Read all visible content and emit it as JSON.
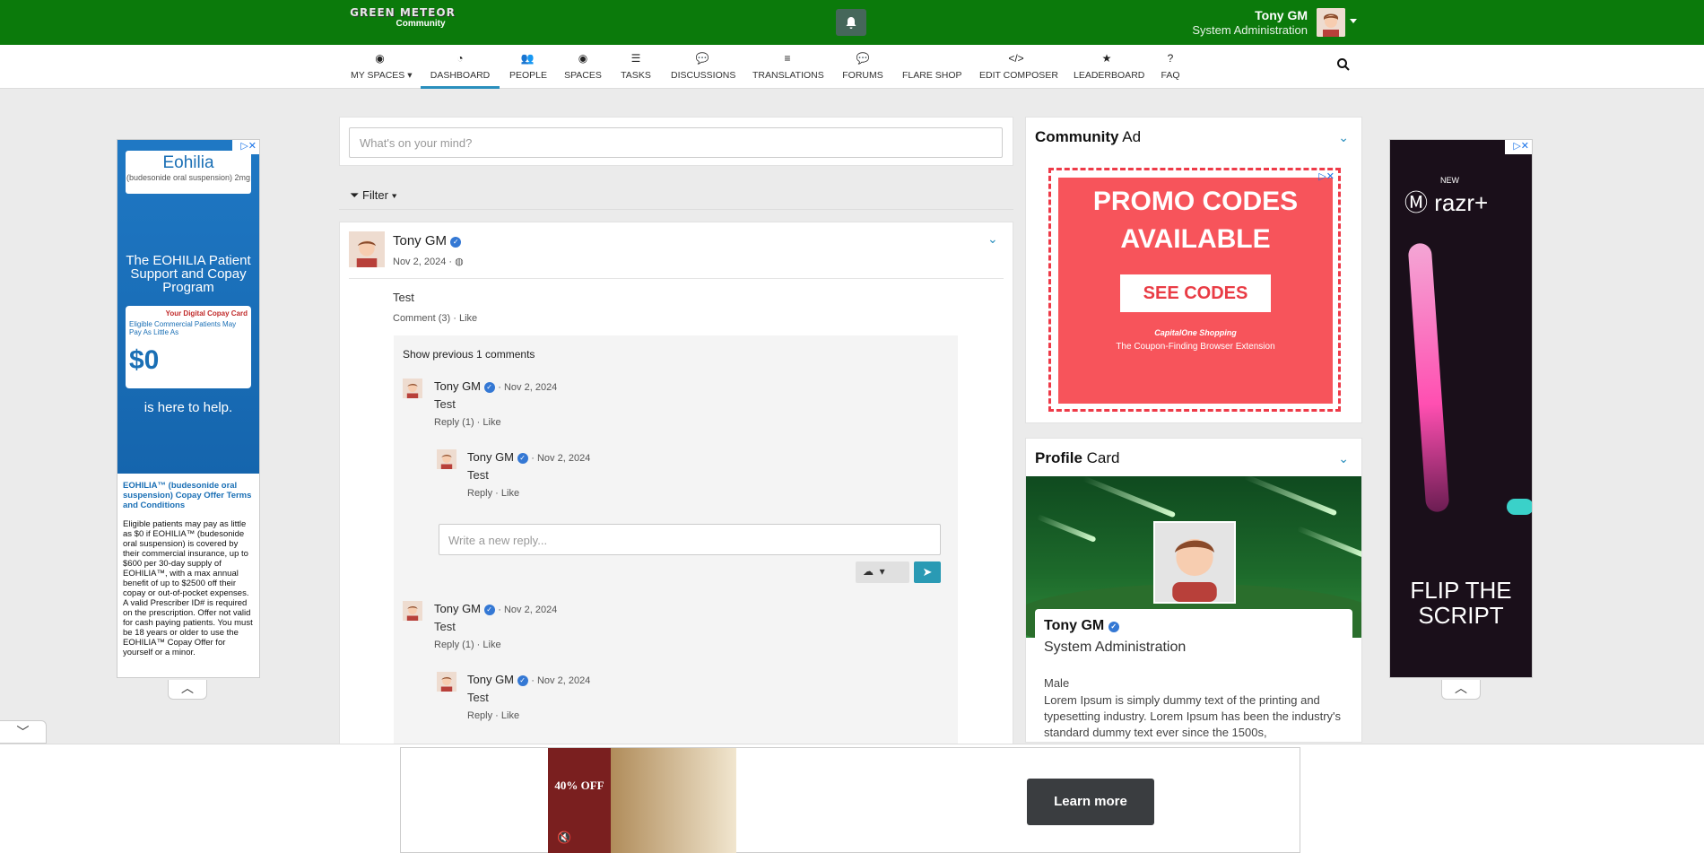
{
  "header": {
    "logo_line1": "GREEN METEOR",
    "logo_line2": "Community",
    "user_name": "Tony GM",
    "user_role": "System Administration",
    "bg_color": "#0b7a0b"
  },
  "nav": {
    "items": [
      {
        "label": "MY SPACES",
        "icon": "target-icon"
      },
      {
        "label": "DASHBOARD",
        "icon": "dashboard-icon"
      },
      {
        "label": "PEOPLE",
        "icon": "people-icon"
      },
      {
        "label": "SPACES",
        "icon": "target-icon"
      },
      {
        "label": "TASKS",
        "icon": "tasks-icon"
      },
      {
        "label": "DISCUSSIONS",
        "icon": "chat-icon"
      },
      {
        "label": "TRANSLATIONS",
        "icon": "lines-icon"
      },
      {
        "label": "FORUMS",
        "icon": "chat-icon"
      },
      {
        "label": "FLARE SHOP",
        "icon": "none"
      },
      {
        "label": "EDIT COMPOSER",
        "icon": "code-icon"
      },
      {
        "label": "LEADERBOARD",
        "icon": "star-icon"
      },
      {
        "label": "FAQ",
        "icon": "question-icon"
      }
    ],
    "active": "DASHBOARD"
  },
  "composer": {
    "placeholder": "What's on your mind?"
  },
  "filter_label": "Filter",
  "post": {
    "author": "Tony GM",
    "date": "Nov 2, 2024",
    "text": "Test",
    "comment_link": "Comment (3)",
    "like": "Like",
    "show_previous": "Show previous 1 comments",
    "comments": [
      {
        "author": "Tony GM",
        "date": "· Nov 2, 2024",
        "text": "Test",
        "reply": "Reply (1)",
        "like": "Like"
      },
      {
        "author": "Tony GM",
        "date": "· Nov 2, 2024",
        "text": "Test",
        "reply": "Reply",
        "like": "Like"
      },
      {
        "author": "Tony GM",
        "date": "· Nov 2, 2024",
        "text": "Test",
        "reply": "Reply (1)",
        "like": "Like"
      },
      {
        "author": "Tony GM",
        "date": "· Nov 2, 2024",
        "text": "Test",
        "reply": "Reply",
        "like": "Like"
      }
    ],
    "reply_placeholder": "Write a new reply..."
  },
  "community_ad": {
    "title_bold": "Community",
    "title_rest": " Ad",
    "headline": "PROMO CODES AVAILABLE",
    "button": "SEE CODES",
    "brand": "CapitalOne Shopping",
    "tagline": "The Coupon-Finding Browser Extension"
  },
  "profile_card": {
    "title_bold": "Profile",
    "title_rest": " Card",
    "name": "Tony GM",
    "role": "System Administration",
    "gender": "Male",
    "bio": "Lorem Ipsum is simply dummy text of the printing and typesetting industry. Lorem Ipsum has been the industry's standard dummy text ever since the 1500s,"
  },
  "left_ad": {
    "brand": "Eohilia",
    "brand_sub": "(budesonide oral suspension) 2mg",
    "headline": "The EOHILIA Patient Support and Copay Program",
    "card_title": "Your Digital Copay Card",
    "card_eligible": "Eligible Commercial Patients May Pay As Little As",
    "card_amount": "$0",
    "help": "is here to help.",
    "terms_title": "EOHILIA™ (budesonide oral suspension) Copay Offer Terms and Conditions",
    "terms_body": "Eligible patients may pay as little as $0 if EOHILIA™ (budesonide oral suspension) is covered by their commercial insurance, up to $600 per 30-day supply of EOHILIA™, with a max annual benefit of up to $2500 off their copay or out-of-pocket expenses. A valid Prescriber ID# is required on the prescription. Offer not valid for cash paying patients. You must be 18 years or older to use the EOHILIA™ Copay Offer for yourself or a minor."
  },
  "right_ad": {
    "new": "NEW",
    "brand": "razr+",
    "headline": "FLIP THE SCRIPT"
  },
  "bottom_ad": {
    "discount": "40% OFF",
    "cta": "Learn more"
  }
}
